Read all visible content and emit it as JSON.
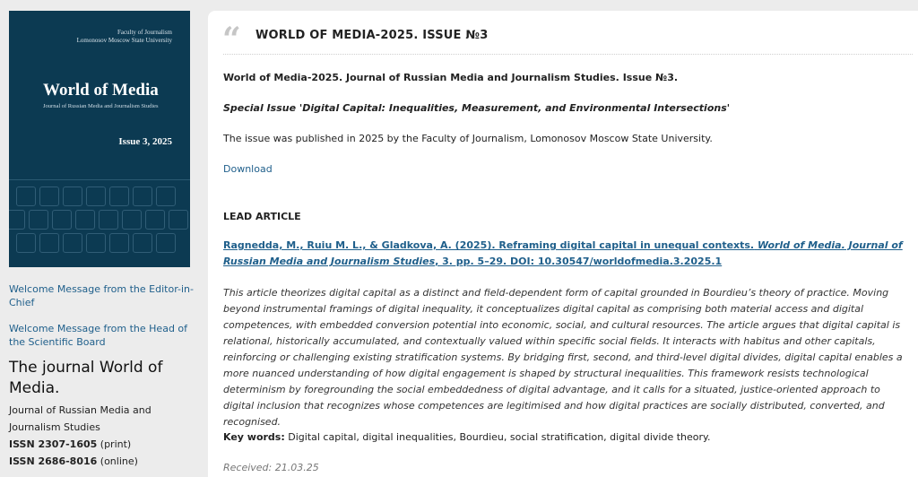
{
  "sidebar": {
    "cover": {
      "faculty": "Faculty of Journalism",
      "university": "Lomonosov Moscow State University",
      "title": "World of Media",
      "subtitle": "Journal of Russian Media and Journalism Studies",
      "issue": "Issue 3, 2025",
      "background_color": "#0c3a52"
    },
    "links": [
      {
        "label": "Welcome Message from the Editor-in-Chief"
      },
      {
        "label": "Welcome Message from the Head of the Scientific Board"
      }
    ],
    "journal": {
      "heading": "The journal World of Media.",
      "description": "Journal of Russian Media and Journalism Studies",
      "issn_print_label": "ISSN 2307-1605",
      "issn_print_note": "(print)",
      "issn_online_label": "ISSN 2686-8016",
      "issn_online_note": "(online)"
    }
  },
  "main": {
    "quote_icon": "quote-mark-icon",
    "title": "WORLD OF MEDIA-2025. ISSUE №3",
    "journal_line": "World of Media-2025. Journal of Russian Media and Journalism Studies. Issue №3.",
    "special_issue": "Special Issue 'Digital Capital: Inequalities, Measurement, and Environmental Intersections'",
    "published": "The issue was published in 2025 by the Faculty of Journalism, Lomonosov Moscow State University.",
    "download_label": "Download",
    "lead_heading": "LEAD ARTICLE",
    "article": {
      "authors_title": "Ragnedda, M., Ruiu M. L., & Gladkova, A. (2025). Reframing digital capital in unequal contexts.",
      "journal_italic": "World of Media. Journal of Russian Media and Journalism Studies",
      "citation_tail": ", 3. pp. 5–29. DOI: 10.30547/worldofmedia.3.2025.1"
    },
    "abstract": "This article theorizes digital capital as a distinct and field-dependent form of capital grounded in Bourdieu’s theory of practice. Moving beyond instrumental framings of digital inequality, it conceptualizes digital capital as comprising both material access and digital competences, with embedded conversion potential into economic, social, and cultural resources. The article argues that digital capital is relational, historically accumulated, and contextually valued within specific social fields. It interacts with habitus and other capitals, reinforcing or challenging existing stratification systems. By bridging first, second, and third-level digital divides, digital capital enables a more nuanced understanding of how digital engagement is shaped by structural inequalities. This framework resists technological determinism by foregrounding the social embeddedness of digital advantage, and it calls for a situated, justice-oriented approach to digital inclusion that recognizes whose competences are legitimised and how digital practices are socially distributed, converted, and recognised.",
    "keywords_label": "Key words:",
    "keywords": "Digital capital, digital inequalities, Bourdieu, social stratification, digital divide theory.",
    "received_partial": "Received: 21.03.25"
  },
  "colors": {
    "link": "#1f5f8b",
    "page_background": "#ececec",
    "panel_background": "#ffffff"
  }
}
